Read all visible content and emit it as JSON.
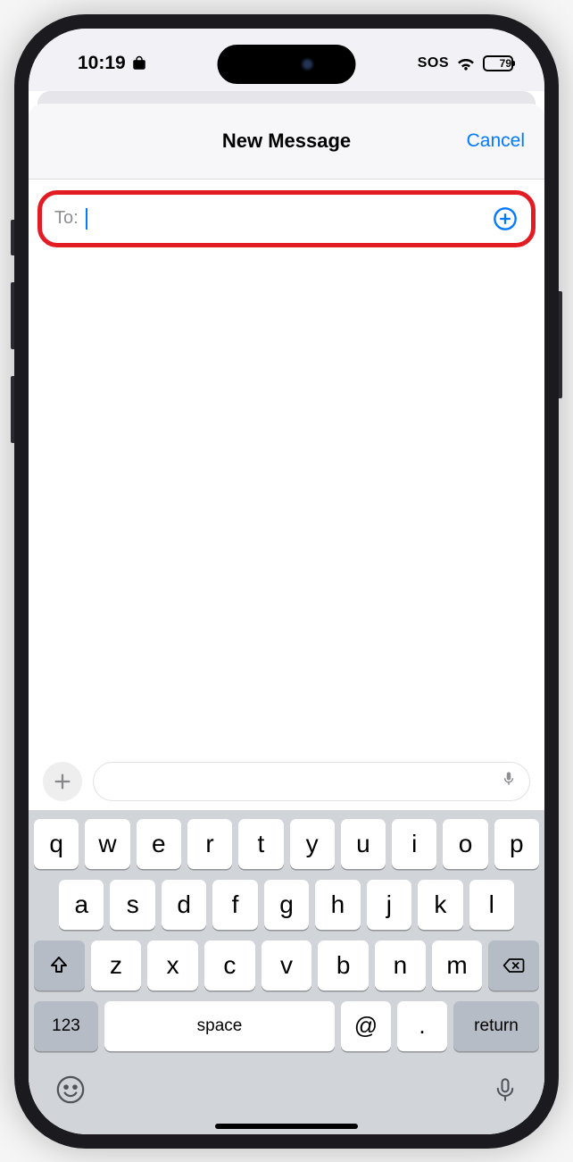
{
  "status": {
    "time": "10:19",
    "sos": "SOS",
    "battery": "79",
    "battery_fill_pct": 79
  },
  "sheet": {
    "title": "New Message",
    "cancel": "Cancel",
    "to_label": "To:"
  },
  "keyboard": {
    "row1": [
      "q",
      "w",
      "e",
      "r",
      "t",
      "y",
      "u",
      "i",
      "o",
      "p"
    ],
    "row2": [
      "a",
      "s",
      "d",
      "f",
      "g",
      "h",
      "j",
      "k",
      "l"
    ],
    "row3": [
      "z",
      "x",
      "c",
      "v",
      "b",
      "n",
      "m"
    ],
    "numKey": "123",
    "space": "space",
    "at": "@",
    "dot": ".",
    "return": "return"
  }
}
